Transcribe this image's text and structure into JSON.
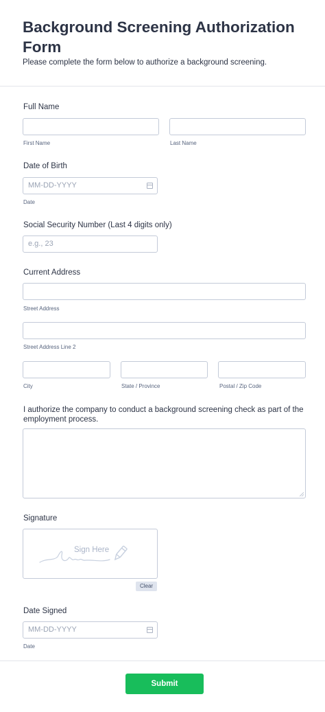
{
  "header": {
    "title": "Background Screening Authorization Form",
    "subtitle": "Please complete the form below to authorize a background screening."
  },
  "full_name": {
    "label": "Full Name",
    "first_sublabel": "First Name",
    "last_sublabel": "Last Name"
  },
  "dob": {
    "label": "Date of Birth",
    "placeholder": "MM-DD-YYYY",
    "sublabel": "Date",
    "icon": "calendar-icon"
  },
  "ssn": {
    "label": "Social Security Number (Last 4 digits only)",
    "placeholder": "e.g., 23"
  },
  "address": {
    "label": "Current Address",
    "street_sublabel": "Street Address",
    "street2_sublabel": "Street Address Line 2",
    "city_sublabel": "City",
    "state_sublabel": "State / Province",
    "zip_sublabel": "Postal / Zip Code"
  },
  "authorization": {
    "label": "I authorize the company to conduct a background screening check as part of the employment process."
  },
  "signature": {
    "label": "Signature",
    "placeholder": "Sign Here",
    "clear_label": "Clear",
    "icon": "pen-icon"
  },
  "date_signed": {
    "label": "Date Signed",
    "placeholder": "MM-DD-YYYY",
    "sublabel": "Date",
    "icon": "calendar-icon"
  },
  "submit_label": "Submit",
  "colors": {
    "submit": "#18bd5b",
    "text": "#2c3345",
    "border": "#c3cad8"
  }
}
